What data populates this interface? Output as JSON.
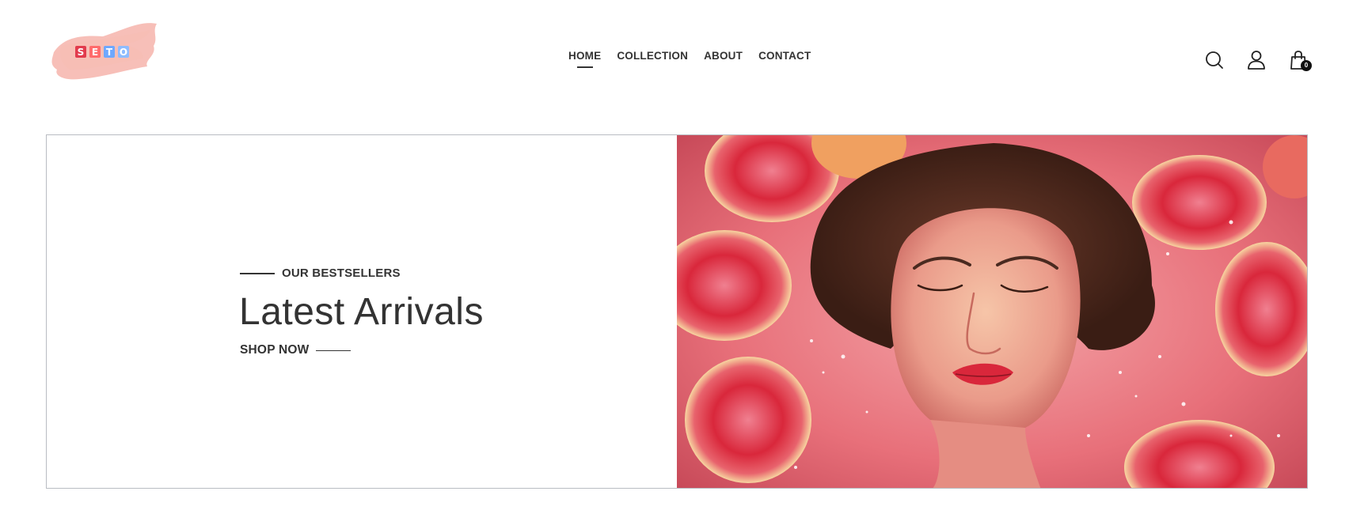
{
  "brand": {
    "logo_letters": [
      "S",
      "E",
      "T",
      "O"
    ],
    "logo_letter_colors": [
      "#e23b4d",
      "#ff6b6b",
      "#6fa8ff",
      "#8fbcff"
    ],
    "logo_splash_color": "#f4a9a0"
  },
  "nav": {
    "items": [
      {
        "label": "HOME",
        "active": true
      },
      {
        "label": "COLLECTION",
        "active": false
      },
      {
        "label": "ABOUT",
        "active": false
      },
      {
        "label": "CONTACT",
        "active": false
      }
    ]
  },
  "header_icons": {
    "search": "search-icon",
    "account": "user-icon",
    "cart": "shopping-bag-icon",
    "cart_count": "0"
  },
  "hero": {
    "eyebrow": "OUR BESTSELLERS",
    "title": "Latest Arrivals",
    "cta_label": "SHOP NOW",
    "image_subject": "woman floating in pink water with grapefruit halves",
    "image_colors": [
      "#e8707a",
      "#f3a5a8",
      "#d9273b",
      "#f6c5a8"
    ]
  }
}
